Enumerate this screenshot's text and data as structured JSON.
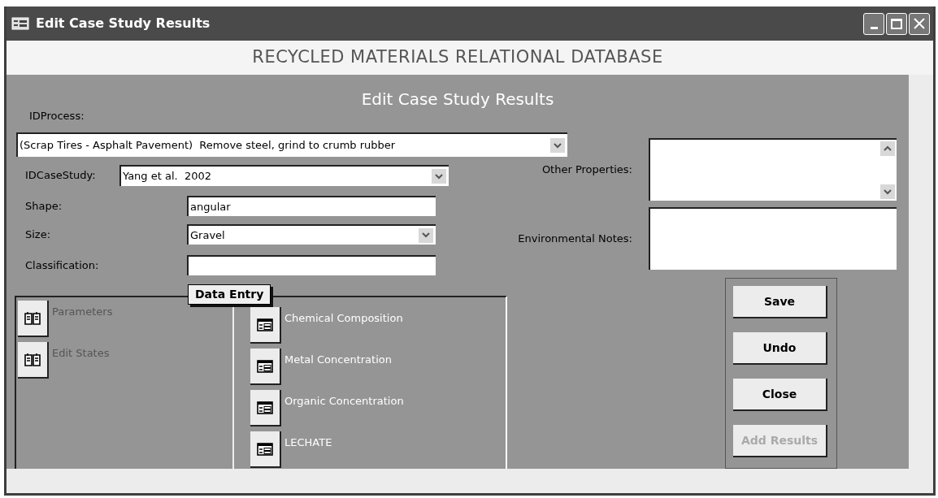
{
  "window": {
    "title": "Edit Case Study Results"
  },
  "header_title": "RECYCLED MATERIALS RELATIONAL DATABASE",
  "form_title": "Edit Case Study Results",
  "process": {
    "label": "IDProcess:",
    "value": "(Scrap Tires - Asphalt Pavement)  Remove steel, grind to crumb rubber",
    "kind": "combo"
  },
  "fields": [
    {
      "label": "IDCaseStudy:",
      "value": "Yang et al.  2002",
      "kind": "combo"
    },
    {
      "label": "Shape:",
      "value": "angular",
      "kind": "text"
    },
    {
      "label": "Size:",
      "value": "Gravel",
      "kind": "combo"
    },
    {
      "label": "Classification:",
      "kind": "text"
    }
  ],
  "notes": [
    {
      "label": "Other Properties:",
      "kind": "scrolling"
    },
    {
      "label": "Environmental Notes:",
      "kind": "plain"
    }
  ],
  "tabs": [
    {
      "label": "Data Entry",
      "selected": true
    }
  ],
  "left_items": [
    {
      "label": "Parameters"
    },
    {
      "label": "Edit States"
    }
  ],
  "right_items": [
    {
      "label": "Chemical Composition"
    },
    {
      "label": "Metal Concentration"
    },
    {
      "label": "Organic Concentration"
    },
    {
      "label": "LECHATE"
    }
  ],
  "buttons": [
    {
      "label": "Save",
      "disabled": false
    },
    {
      "label": "Undo",
      "disabled": false
    },
    {
      "label": "Close",
      "disabled": false
    },
    {
      "label": "Add Results",
      "disabled": true
    }
  ]
}
